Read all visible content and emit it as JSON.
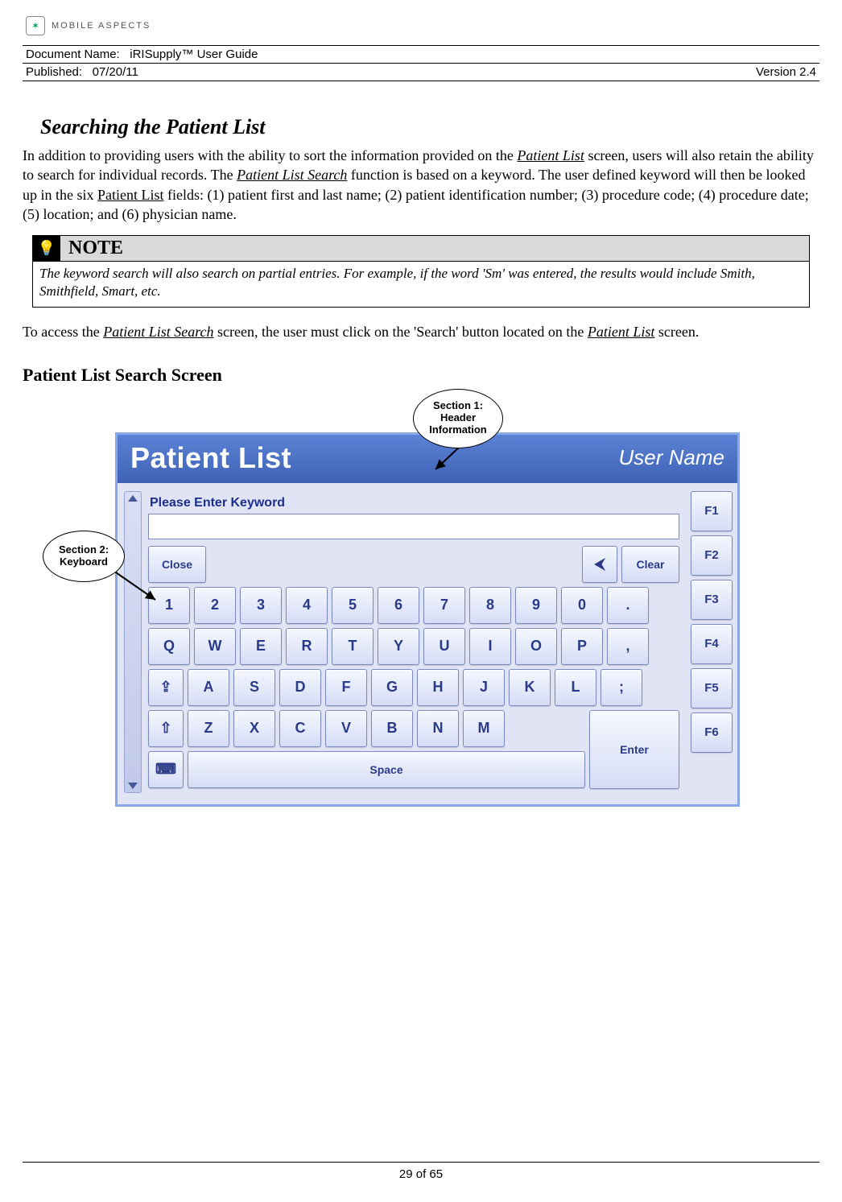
{
  "logo": {
    "brand": "MOBILE ASPECTS"
  },
  "meta": {
    "doc_label": "Document Name:",
    "doc_value": "iRISupply™ User Guide",
    "pub_label": "Published:",
    "pub_value": "07/20/11",
    "version": "Version 2.4"
  },
  "section_title": "Searching the Patient List",
  "para1_pre": "In addition to providing users with the ability to sort the information provided on the ",
  "para1_u1": "Patient List",
  "para1_mid1": " screen, users will also retain the ability to search for individual records.  The ",
  "para1_u2": "Patient List Search",
  "para1_mid2": " function is based on a keyword.  The user defined keyword will then be looked up in the six ",
  "para1_u3": "Patient List",
  "para1_tail": " fields: (1) patient first and last name; (2) patient identification number; (3) procedure code; (4) procedure date; (5) location; and (6) physician name.",
  "note": {
    "label": "NOTE",
    "body": "The keyword search will also search on partial entries.  For example, if the word 'Sm' was entered, the results would include Smith, Smithfield, Smart, etc."
  },
  "para2_pre": "To access the ",
  "para2_u1": "Patient List Search",
  "para2_mid": " screen, the user must click on the 'Search' button located on the ",
  "para2_u2": "Patient List",
  "para2_tail": " screen.",
  "subhead": "Patient List Search Screen",
  "callouts": {
    "c1_l1": "Section 1:",
    "c1_l2": "Header",
    "c1_l3": "Information",
    "c2_l1": "Section 2:",
    "c2_l2": "Keyboard"
  },
  "app": {
    "title": "Patient List",
    "user": "User Name",
    "kw_label": "Please Enter Keyword",
    "keys": {
      "close": "Close",
      "back": "⮜",
      "clear": "Clear",
      "row_num": [
        "1",
        "2",
        "3",
        "4",
        "5",
        "6",
        "7",
        "8",
        "9",
        "0",
        "."
      ],
      "row_q": [
        "Q",
        "W",
        "E",
        "R",
        "T",
        "Y",
        "U",
        "I",
        "O",
        "P",
        ","
      ],
      "row_a": [
        "A",
        "S",
        "D",
        "F",
        "G",
        "H",
        "J",
        "K",
        "L",
        ";"
      ],
      "row_z": [
        "Z",
        "X",
        "C",
        "V",
        "B",
        "N",
        "M"
      ],
      "shift": "⇧",
      "caps": "⇪",
      "alt": "⌨",
      "space": "Space",
      "enter": "Enter",
      "fn": [
        "F1",
        "F2",
        "F3",
        "F4",
        "F5",
        "F6"
      ]
    }
  },
  "footer": "29 of 65"
}
